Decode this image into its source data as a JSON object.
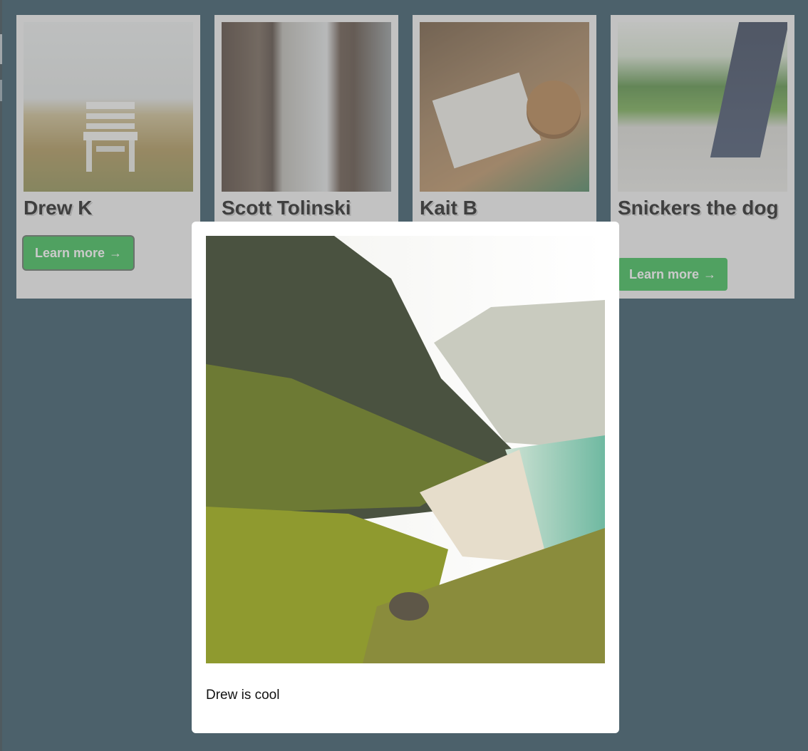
{
  "profiles": [
    {
      "name": "Drew K",
      "button_label": "Learn more"
    },
    {
      "name": "Scott Tolinski"
    },
    {
      "name": "Kait B"
    },
    {
      "name": "Snickers the dog",
      "button_label": "Learn more"
    }
  ],
  "button_arrow": "→",
  "modal": {
    "description": "Drew is cool"
  },
  "colors": {
    "page_background": "#264a5c",
    "button": "#2eb84b",
    "card": "#f1f1f1",
    "modal": "#ffffff"
  },
  "icons": {
    "arrow": "arrow-right-icon"
  }
}
